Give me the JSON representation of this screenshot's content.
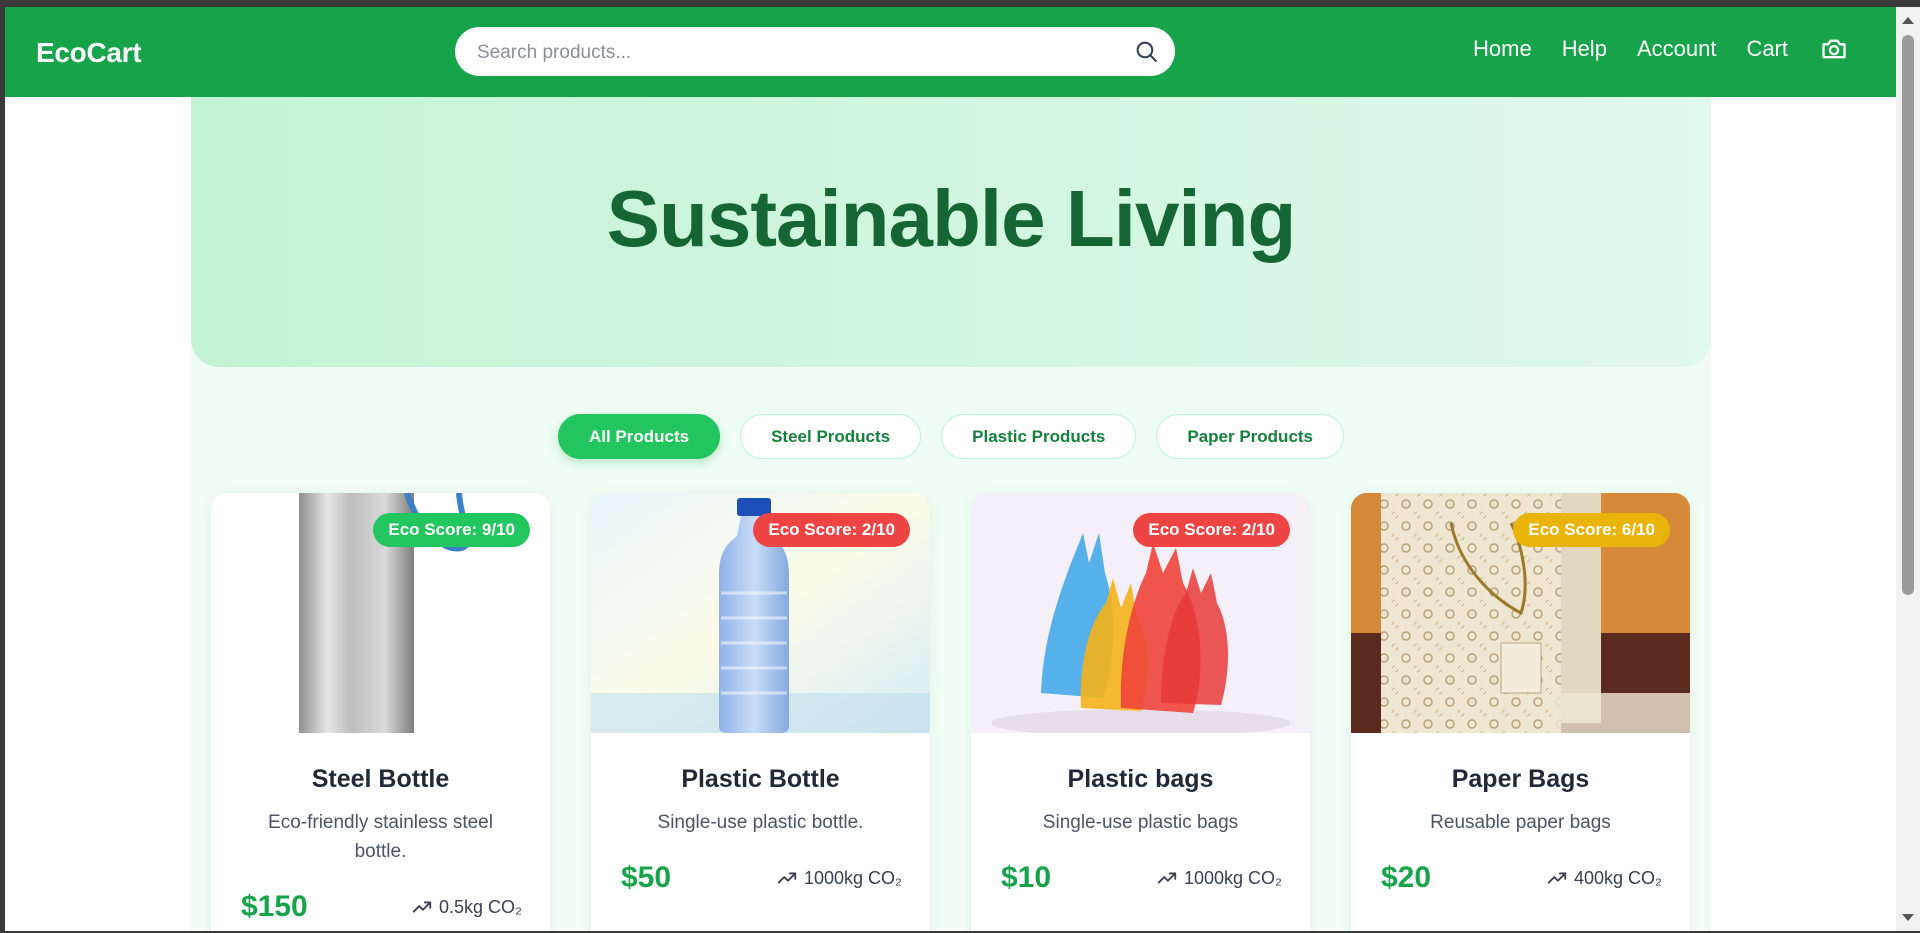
{
  "navbar": {
    "brand": "EcoCart",
    "search_placeholder": "Search products...",
    "links": [
      "Home",
      "Help",
      "Account",
      "Cart"
    ],
    "icons": {
      "search": "search-icon",
      "camera": "camera-icon"
    },
    "background_color": "#16a34a"
  },
  "hero": {
    "title": "Sustainable Living"
  },
  "filters": [
    {
      "label": "All Products",
      "active": true
    },
    {
      "label": "Steel Products",
      "active": false
    },
    {
      "label": "Plastic Products",
      "active": false
    },
    {
      "label": "Paper Products",
      "active": false
    }
  ],
  "products": [
    {
      "name": "Steel Bottle",
      "description": "Eco-friendly stainless steel bottle.",
      "price": "$150",
      "co2": "0.5kg CO₂",
      "eco_score": "Eco Score: 9/10",
      "eco_score_value": 9,
      "badge_color": "#22c55e"
    },
    {
      "name": "Plastic Bottle",
      "description": "Single-use plastic bottle.",
      "price": "$50",
      "co2": "1000kg CO₂",
      "eco_score": "Eco Score: 2/10",
      "eco_score_value": 2,
      "badge_color": "#ef4444"
    },
    {
      "name": "Plastic bags",
      "description": "Single-use plastic bags",
      "price": "$10",
      "co2": "1000kg CO₂",
      "eco_score": "Eco Score: 2/10",
      "eco_score_value": 2,
      "badge_color": "#ef4444"
    },
    {
      "name": "Paper Bags",
      "description": "Reusable paper bags",
      "price": "$20",
      "co2": "400kg CO₂",
      "eco_score": "Eco Score: 6/10",
      "eco_score_value": 6,
      "badge_color": "#eab308"
    }
  ],
  "colors": {
    "accent": "#16a34a",
    "hero_text": "#166534",
    "price": "#16a34a"
  }
}
